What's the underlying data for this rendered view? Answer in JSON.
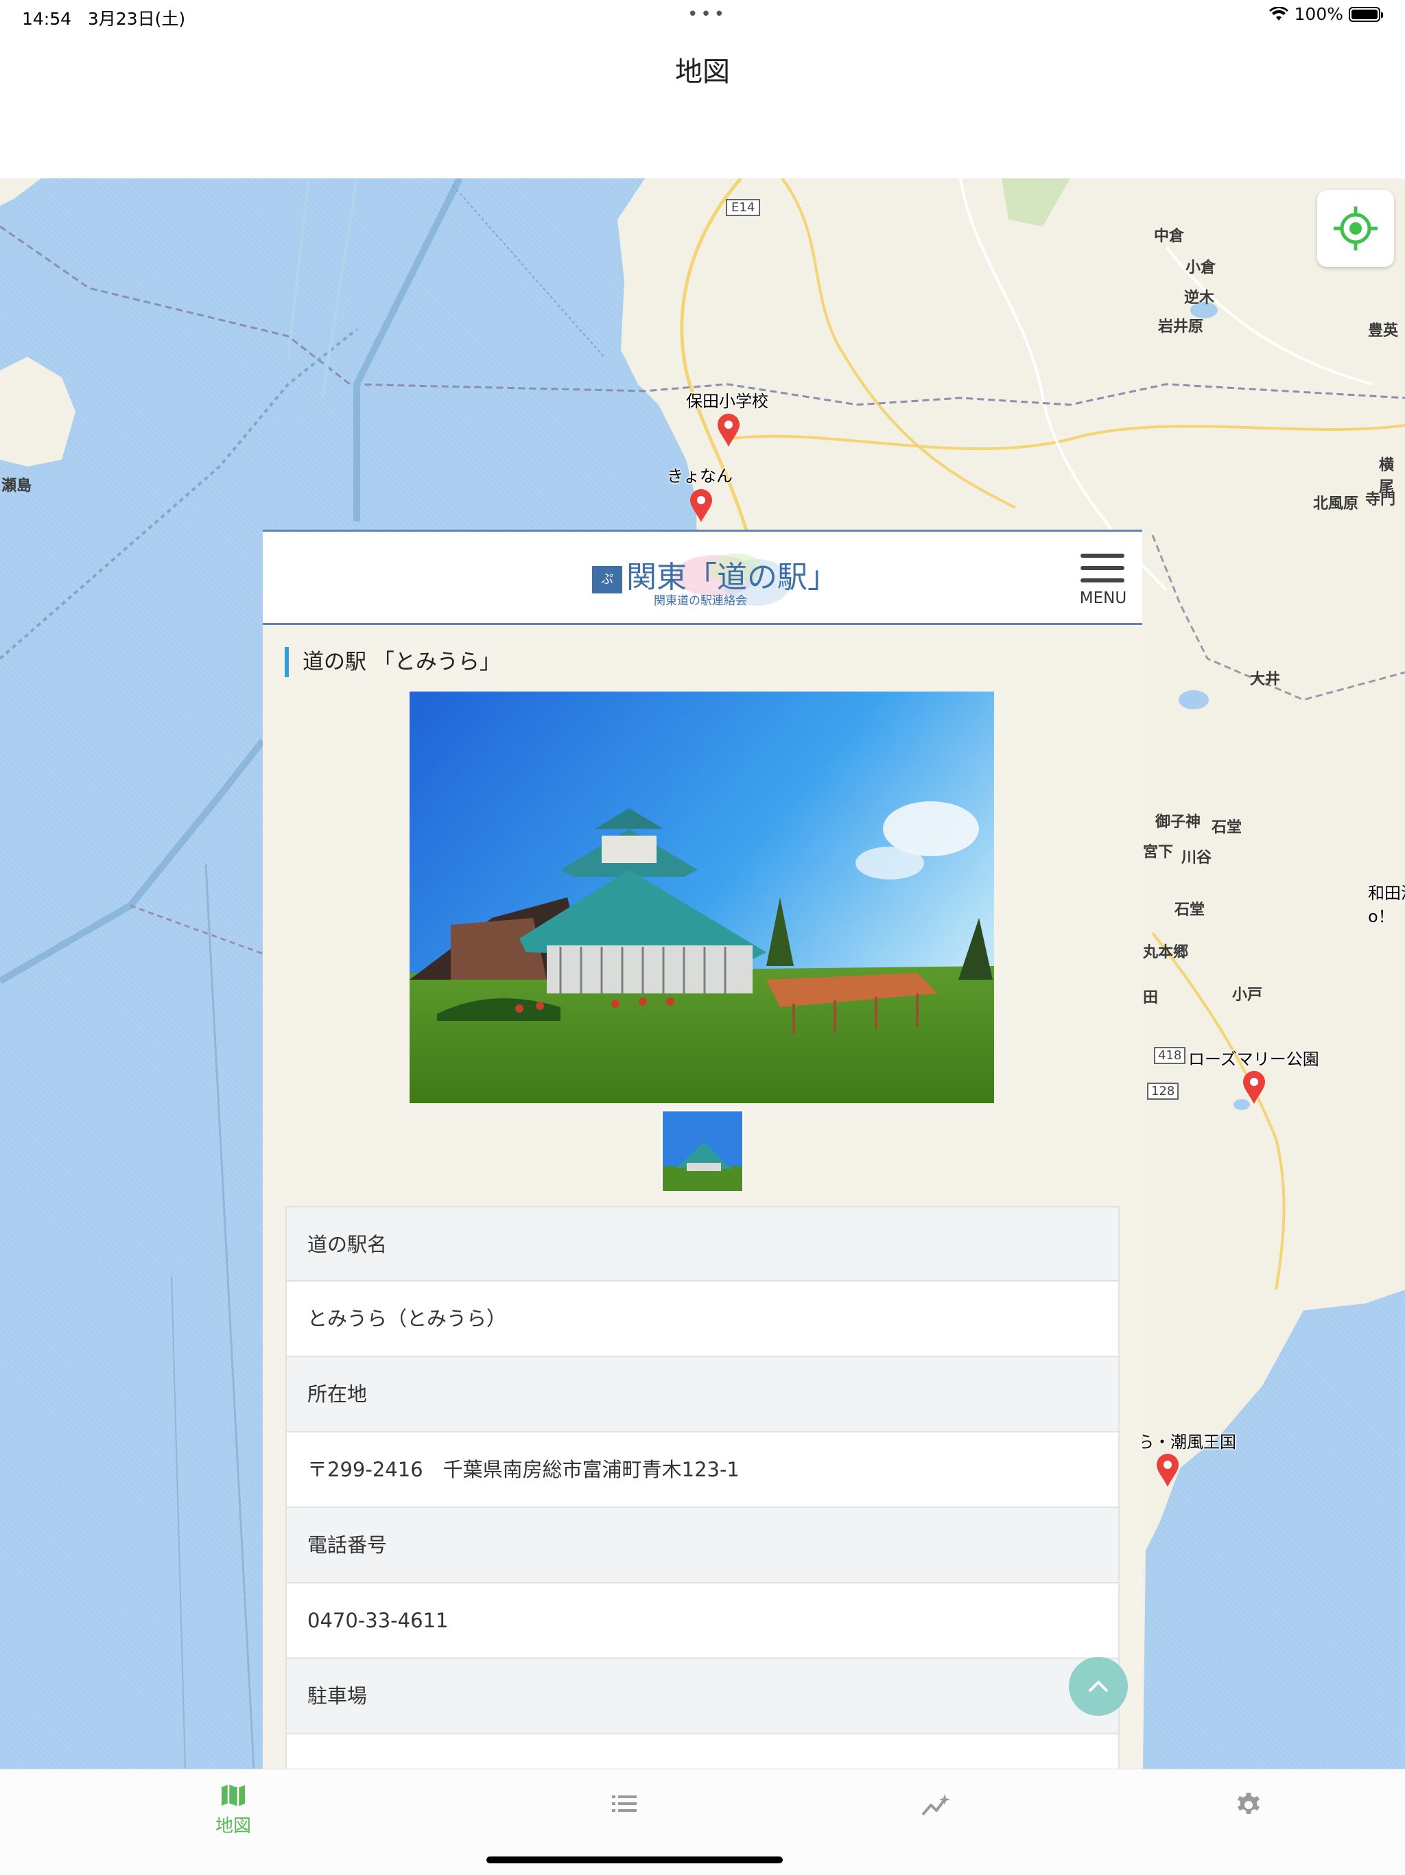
{
  "status_bar": {
    "time": "14:54",
    "date": "3月23日(土)",
    "battery_text": "100%",
    "battery_level": 1.0
  },
  "nav": {
    "title": "地図"
  },
  "map": {
    "area_labels": [
      "中倉",
      "小倉",
      "逆木",
      "岩井原",
      "豊英",
      "横尾",
      "北風原",
      "寺門",
      "大井",
      "御子神",
      "石堂",
      "宮下",
      "川谷",
      "石堂",
      "丸本郷",
      "田",
      "小戸",
      "瀬島"
    ],
    "road_labels": [
      "E14",
      "418",
      "128"
    ],
    "pins": [
      {
        "label": "保田小学校"
      },
      {
        "label": "きょなん"
      },
      {
        "label": "ローズマリー公園"
      },
      {
        "label": "ら・潮風王国"
      },
      {
        "label": "和田浦",
        "label2": "o！"
      }
    ],
    "colors": {
      "sea": "#a9cdee",
      "land": "#f3f0e6",
      "pin": "#e9403b",
      "accent": "#5cb85c"
    }
  },
  "panel": {
    "logo_badge": "ぷ",
    "logo_text": "関東「道の駅」",
    "logo_sub": "関東道の駅連絡会",
    "menu_label": "MENU",
    "station_title": "道の駅 「とみうら」",
    "rows": [
      {
        "kind": "head",
        "text": "道の駅名"
      },
      {
        "kind": "val",
        "text": "とみうら（とみうら）"
      },
      {
        "kind": "head",
        "text": "所在地"
      },
      {
        "kind": "val",
        "text": "〒299-2416　千葉県南房総市富浦町青木123-1"
      },
      {
        "kind": "head",
        "text": "電話番号"
      },
      {
        "kind": "val",
        "text": "0470-33-4611"
      },
      {
        "kind": "head",
        "text": "駐車場"
      },
      {
        "kind": "val",
        "text": ""
      }
    ]
  },
  "tabs": [
    {
      "icon": "map-icon",
      "label": "地図",
      "active": true
    },
    {
      "icon": "list-icon",
      "label": "",
      "active": false
    },
    {
      "icon": "chart-icon",
      "label": "",
      "active": false
    },
    {
      "icon": "gear-icon",
      "label": "",
      "active": false
    }
  ]
}
